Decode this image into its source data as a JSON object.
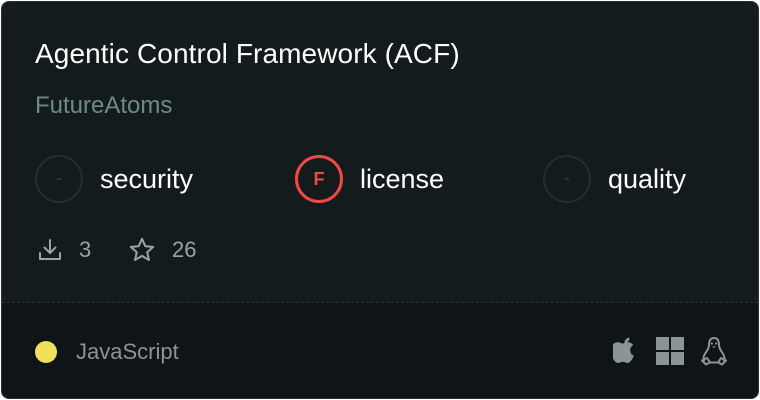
{
  "package": {
    "title": "Agentic Control Framework (ACF)",
    "owner": "FutureAtoms"
  },
  "scores": [
    {
      "label": "security",
      "badge": "-",
      "status": "none"
    },
    {
      "label": "license",
      "badge": "F",
      "status": "fail",
      "color": "#ef4848"
    },
    {
      "label": "quality",
      "badge": "-",
      "status": "none"
    }
  ],
  "stats": {
    "downloads": "3",
    "stars": "26",
    "download_icon": "download-icon",
    "star_icon": "star-icon"
  },
  "language": {
    "name": "JavaScript",
    "color": "#f1e05a"
  },
  "platforms": [
    "apple-icon",
    "windows-icon",
    "linux-icon"
  ]
}
